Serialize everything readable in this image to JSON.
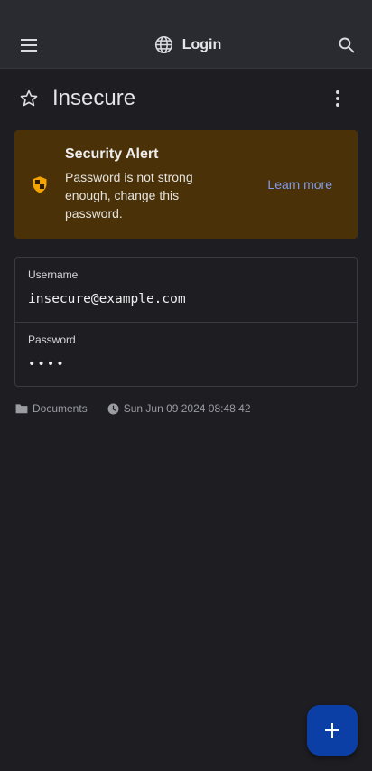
{
  "appbar": {
    "title": "Login",
    "icons": [
      "menu-icon",
      "globe-icon",
      "search-icon"
    ]
  },
  "item": {
    "title": "Insecure",
    "favorite": false
  },
  "alert": {
    "title": "Security Alert",
    "message": "Password is not strong enough, change this password.",
    "link_label": "Learn more",
    "accent_color": "#f5a300",
    "background_color": "#4a3107"
  },
  "fields": {
    "username": {
      "label": "Username",
      "value": "insecure@example.com"
    },
    "password": {
      "label": "Password",
      "value": "••••"
    }
  },
  "meta": {
    "folder": "Documents",
    "modified": "Sun Jun 09 2024 08:48:42"
  },
  "fab": {
    "icon": "plus-icon",
    "color": "#0b3fa6"
  }
}
